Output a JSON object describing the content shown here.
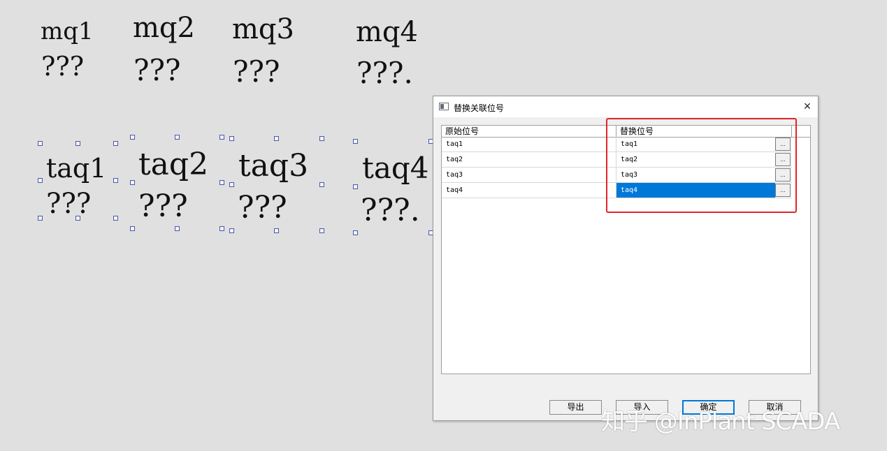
{
  "canvas": {
    "mq_labels": [
      "mq1",
      "mq2",
      "mq3",
      "mq4"
    ],
    "mq_values": [
      "???",
      "???",
      "???",
      "???."
    ],
    "taq_labels": [
      "taq1",
      "taq2",
      "taq3",
      "taq4"
    ],
    "taq_values": [
      "???",
      "???",
      "???",
      "???."
    ]
  },
  "dialog": {
    "title": "替换关联位号",
    "close_label": "×",
    "columns": {
      "original": "原始位号",
      "replacement": "替换位号"
    },
    "rows": [
      {
        "original": "taq1",
        "replacement": "taq1"
      },
      {
        "original": "taq2",
        "replacement": "taq2"
      },
      {
        "original": "taq3",
        "replacement": "taq3"
      },
      {
        "original": "taq4",
        "replacement": "taq4",
        "selected": true
      }
    ],
    "ellipsis_label": "...",
    "buttons": {
      "export": "导出",
      "import": "导入",
      "ok": "确定",
      "cancel": "取消"
    }
  },
  "watermark": "知乎 @InPlant SCADA",
  "colors": {
    "selection": "#0078d7",
    "highlight_box": "#e0262a",
    "background": "#e0e0e0"
  }
}
